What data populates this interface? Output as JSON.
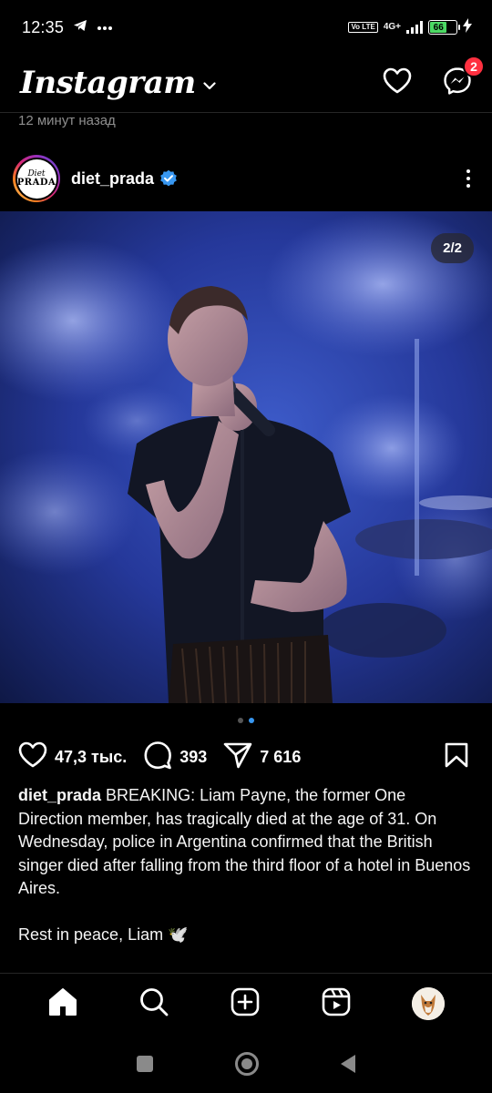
{
  "status_bar": {
    "time": "12:35",
    "icons": [
      "telegram-icon",
      "more-notifications-icon"
    ],
    "volte": "Vo LTE",
    "network": "4G+",
    "battery_level": "66",
    "charging": true
  },
  "header": {
    "logo": "Instagram",
    "notifications_icon": "heart-icon",
    "messenger_icon": "messenger-icon",
    "messenger_badge": "2"
  },
  "feed": {
    "time_ago": "12 минут назад"
  },
  "post": {
    "username": "diet_prada",
    "verified": true,
    "avatar_text_line1": "Diet",
    "avatar_text_line2": "PRADA",
    "carousel_counter": "2/2",
    "carousel_total": 2,
    "carousel_active": 2,
    "likes": "47,3 тыс.",
    "comments": "393",
    "shares": "7 616",
    "caption_user": "diet_prada",
    "caption_text": "BREAKING: Liam Payne, the former One Direction member, has tragically died at the age of 31. On Wednesday, police in Argentina confirmed that the British singer died after falling from the third floor of a hotel in Buenos Aires.",
    "caption_closing": "Rest in peace, Liam 🕊️"
  },
  "bottom_nav": {
    "items": [
      "home-icon",
      "search-icon",
      "create-icon",
      "reels-icon",
      "profile-avatar"
    ]
  },
  "system_nav": {
    "items": [
      "recents-button",
      "home-button",
      "back-button"
    ]
  },
  "colors": {
    "background": "#000000",
    "accent_blue": "#3897f0",
    "badge_red": "#ff3040",
    "secondary_text": "#8e8e8e"
  }
}
